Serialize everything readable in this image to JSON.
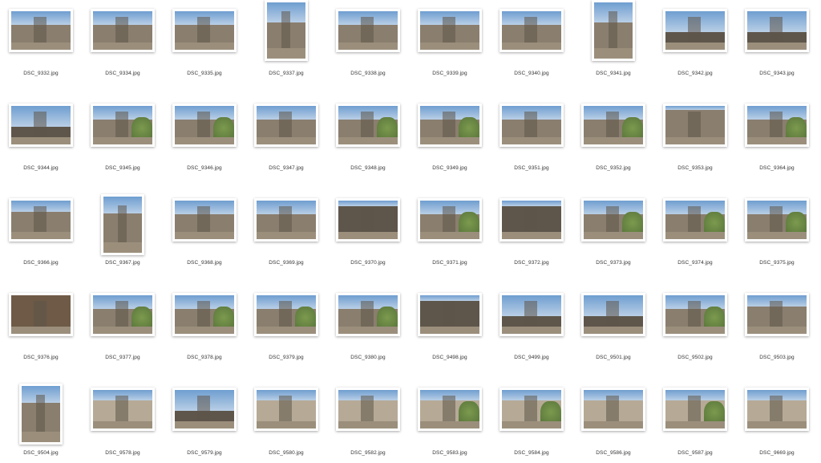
{
  "files": [
    {
      "name": "DSC_9332.jpg",
      "orientation": "landscape",
      "scene": "street"
    },
    {
      "name": "DSC_9334.jpg",
      "orientation": "landscape",
      "scene": "facade-tower"
    },
    {
      "name": "DSC_9335.jpg",
      "orientation": "landscape",
      "scene": "facade"
    },
    {
      "name": "DSC_9337.jpg",
      "orientation": "portrait",
      "scene": "alley-tower"
    },
    {
      "name": "DSC_9338.jpg",
      "orientation": "landscape",
      "scene": "plaza"
    },
    {
      "name": "DSC_9339.jpg",
      "orientation": "landscape",
      "scene": "facade-tower"
    },
    {
      "name": "DSC_9340.jpg",
      "orientation": "landscape",
      "scene": "plaza-tower"
    },
    {
      "name": "DSC_9341.jpg",
      "orientation": "portrait",
      "scene": "towers"
    },
    {
      "name": "DSC_9342.jpg",
      "orientation": "landscape",
      "scene": "towers-sky"
    },
    {
      "name": "DSC_9343.jpg",
      "orientation": "landscape",
      "scene": "towers-sky"
    },
    {
      "name": "DSC_9344.jpg",
      "orientation": "landscape",
      "scene": "towers-sky"
    },
    {
      "name": "DSC_9345.jpg",
      "orientation": "landscape",
      "scene": "facade-tree"
    },
    {
      "name": "DSC_9346.jpg",
      "orientation": "landscape",
      "scene": "plaza-tree"
    },
    {
      "name": "DSC_9347.jpg",
      "orientation": "landscape",
      "scene": "facade-tower"
    },
    {
      "name": "DSC_9348.jpg",
      "orientation": "landscape",
      "scene": "garden-wall"
    },
    {
      "name": "DSC_9349.jpg",
      "orientation": "landscape",
      "scene": "plaza-tree"
    },
    {
      "name": "DSC_9351.jpg",
      "orientation": "landscape",
      "scene": "arch"
    },
    {
      "name": "DSC_9352.jpg",
      "orientation": "landscape",
      "scene": "plaza-tree"
    },
    {
      "name": "DSC_9353.jpg",
      "orientation": "landscape",
      "scene": "stone-wall"
    },
    {
      "name": "DSC_9364.jpg",
      "orientation": "landscape",
      "scene": "garden-wall"
    },
    {
      "name": "DSC_9366.jpg",
      "orientation": "landscape",
      "scene": "cathedral"
    },
    {
      "name": "DSC_9367.jpg",
      "orientation": "portrait",
      "scene": "cathedral"
    },
    {
      "name": "DSC_9368.jpg",
      "orientation": "landscape",
      "scene": "arch"
    },
    {
      "name": "DSC_9369.jpg",
      "orientation": "landscape",
      "scene": "arch"
    },
    {
      "name": "DSC_9370.jpg",
      "orientation": "landscape",
      "scene": "stairs"
    },
    {
      "name": "DSC_9371.jpg",
      "orientation": "landscape",
      "scene": "garden-wall"
    },
    {
      "name": "DSC_9372.jpg",
      "orientation": "landscape",
      "scene": "alley"
    },
    {
      "name": "DSC_9373.jpg",
      "orientation": "landscape",
      "scene": "garden-wall"
    },
    {
      "name": "DSC_9374.jpg",
      "orientation": "landscape",
      "scene": "garden-wall"
    },
    {
      "name": "DSC_9375.jpg",
      "orientation": "landscape",
      "scene": "garden-wall"
    },
    {
      "name": "DSC_9376.jpg",
      "orientation": "landscape",
      "scene": "texture"
    },
    {
      "name": "DSC_9377.jpg",
      "orientation": "landscape",
      "scene": "garden"
    },
    {
      "name": "DSC_9378.jpg",
      "orientation": "landscape",
      "scene": "garden-wall"
    },
    {
      "name": "DSC_9379.jpg",
      "orientation": "landscape",
      "scene": "garden-wall"
    },
    {
      "name": "DSC_9380.jpg",
      "orientation": "landscape",
      "scene": "garden"
    },
    {
      "name": "DSC_9498.jpg",
      "orientation": "landscape",
      "scene": "alley"
    },
    {
      "name": "DSC_9499.jpg",
      "orientation": "landscape",
      "scene": "towers-sky"
    },
    {
      "name": "DSC_9501.jpg",
      "orientation": "landscape",
      "scene": "towers-sky"
    },
    {
      "name": "DSC_9502.jpg",
      "orientation": "landscape",
      "scene": "garden-wall"
    },
    {
      "name": "DSC_9503.jpg",
      "orientation": "landscape",
      "scene": "cathedral"
    },
    {
      "name": "DSC_9504.jpg",
      "orientation": "portrait",
      "scene": "cathedral"
    },
    {
      "name": "DSC_9578.jpg",
      "orientation": "landscape",
      "scene": "city"
    },
    {
      "name": "DSC_9579.jpg",
      "orientation": "landscape",
      "scene": "towers-sky"
    },
    {
      "name": "DSC_9580.jpg",
      "orientation": "landscape",
      "scene": "city"
    },
    {
      "name": "DSC_9582.jpg",
      "orientation": "landscape",
      "scene": "city"
    },
    {
      "name": "DSC_9583.jpg",
      "orientation": "landscape",
      "scene": "city-garden"
    },
    {
      "name": "DSC_9584.jpg",
      "orientation": "landscape",
      "scene": "city-garden"
    },
    {
      "name": "DSC_9586.jpg",
      "orientation": "landscape",
      "scene": "city"
    },
    {
      "name": "DSC_9587.jpg",
      "orientation": "landscape",
      "scene": "city-garden"
    },
    {
      "name": "DSC_9669.jpg",
      "orientation": "landscape",
      "scene": "city"
    }
  ],
  "palette": {
    "sky": "#b9cfe6",
    "sky_deep": "#6f9ed0",
    "stone": "#8a7e6e",
    "stone_dark": "#5e564b",
    "stone_light": "#b6aa96",
    "foliage": "#4f6b35",
    "foliage_light": "#7c9a4e",
    "ground": "#9b8f7c",
    "caption": "#333333"
  }
}
